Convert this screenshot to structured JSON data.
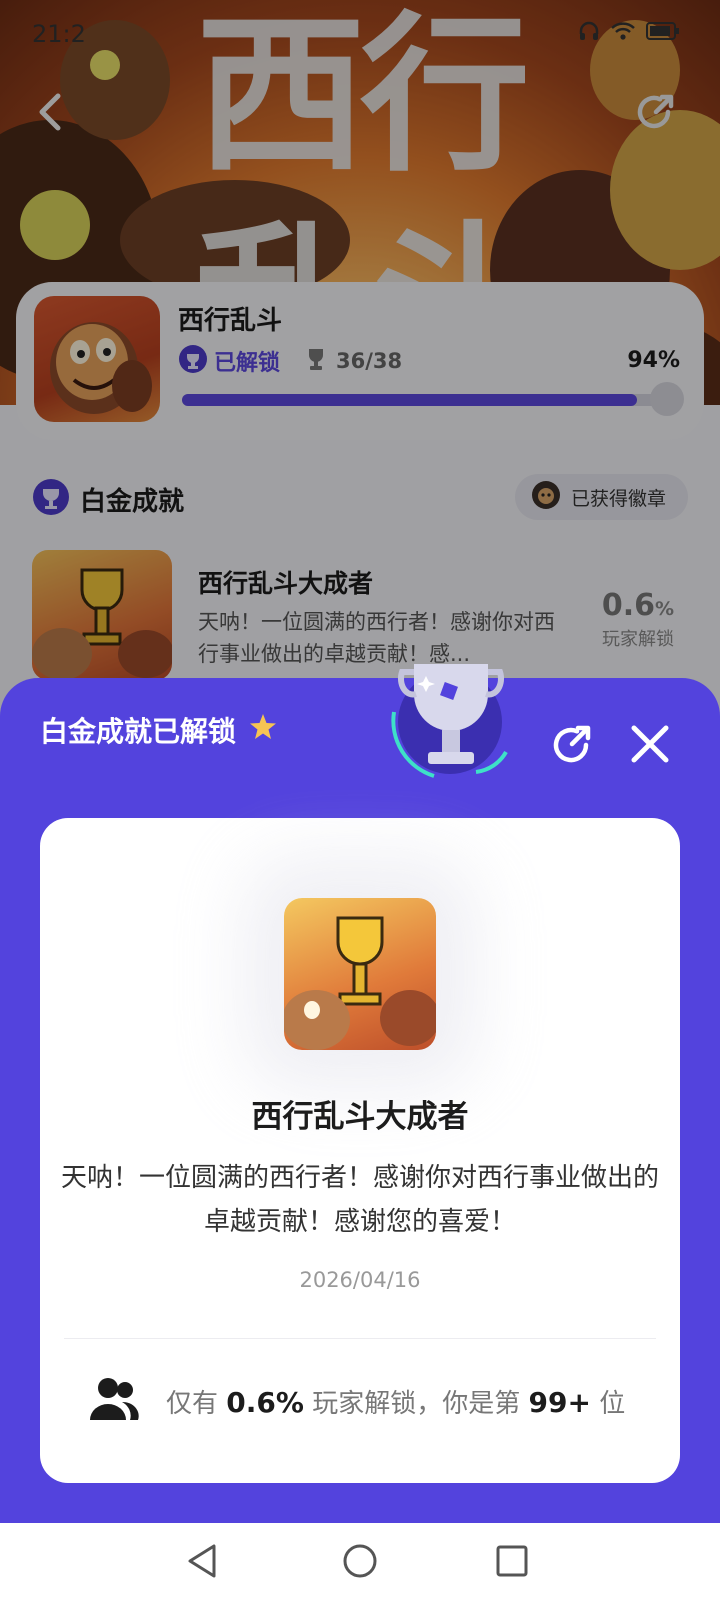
{
  "status_bar": {
    "time": "21:2"
  },
  "banner": {
    "title_line1": "西行",
    "title_line2": "乱斗"
  },
  "game": {
    "name": "西行乱斗",
    "unlock_label": "已解锁",
    "trophy_count": "36/38",
    "percent_text": "94%",
    "progress": 0.94
  },
  "section": {
    "title": "白金成就",
    "badge_button": "已获得徽章"
  },
  "achievement": {
    "title": "西行乱斗大成者",
    "description": "天呐！一位圆满的西行者！感谢你对西行事业做出的卓越贡献！感...",
    "rate_value": "0.6",
    "rate_unit": "%",
    "rate_label": "玩家解锁"
  },
  "sheet": {
    "title": "白金成就已解锁",
    "detail_title": "西行乱斗大成者",
    "detail_desc": "天呐！一位圆满的西行者！感谢你对西行事业做出的卓越贡献！感谢您的喜爱！",
    "date": "2026/04/16",
    "stats": {
      "prefix": "仅有",
      "percent": "0.6%",
      "middle": "玩家解锁，你是第",
      "rank": "99+",
      "suffix": "位"
    }
  },
  "colors": {
    "accent": "#5343dd",
    "progress": "#5b48dd"
  },
  "icons": [
    "back-icon",
    "share-icon",
    "trophy-icon",
    "close-icon",
    "users-icon",
    "star-icon",
    "nav-back-icon",
    "nav-home-icon",
    "nav-recents-icon"
  ]
}
